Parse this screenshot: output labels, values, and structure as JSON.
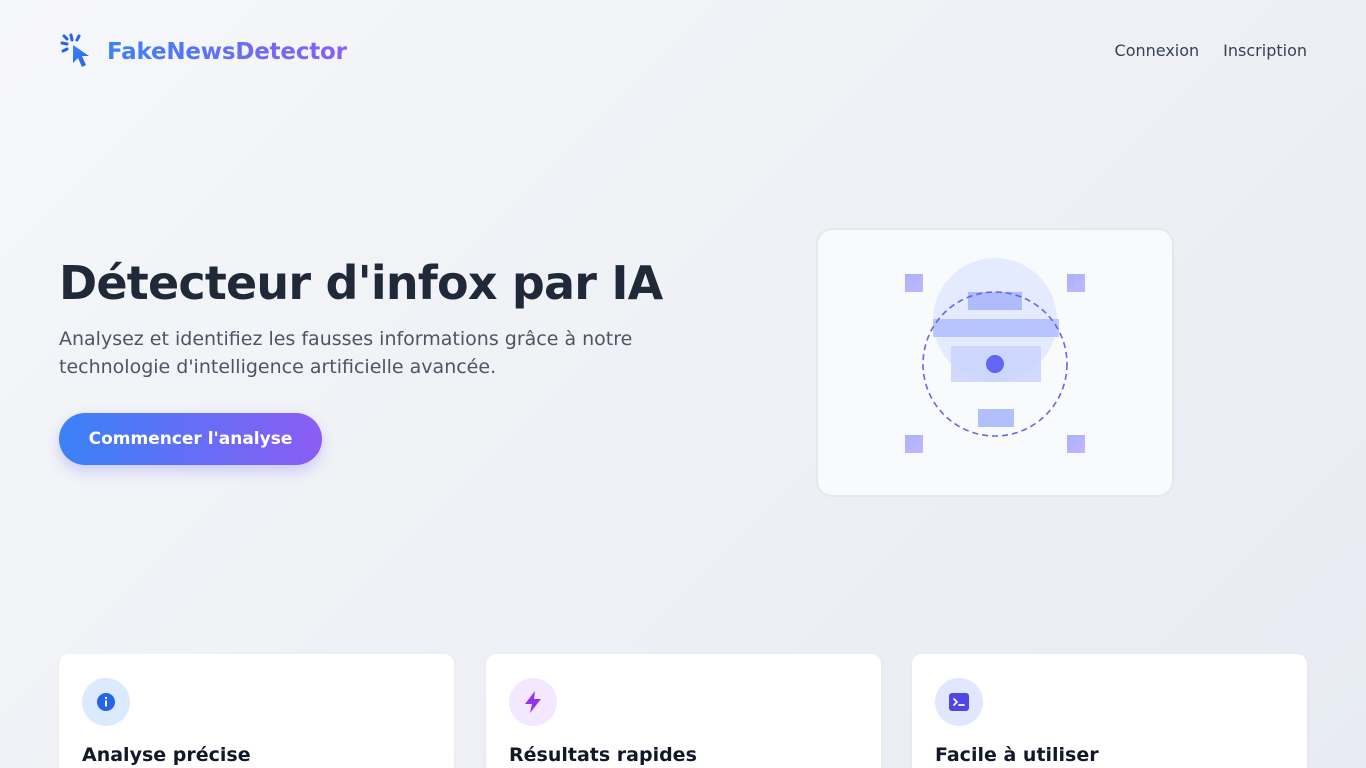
{
  "header": {
    "logo_text": "FakeNewsDetector",
    "nav": {
      "login": "Connexion",
      "signup": "Inscription"
    }
  },
  "hero": {
    "title": "Détecteur d'infox par IA",
    "subtitle": "Analysez et identifiez les fausses informations grâce à notre technologie d'intelligence artificielle avancée.",
    "cta_label": "Commencer l'analyse"
  },
  "features": [
    {
      "title": "Analyse précise",
      "icon": "info-icon",
      "icon_bg": "#dbeafe",
      "icon_color": "#2563eb"
    },
    {
      "title": "Résultats rapides",
      "icon": "lightning-icon",
      "icon_bg": "#f3e8ff",
      "icon_color": "#9333ea"
    },
    {
      "title": "Facile à utiliser",
      "icon": "terminal-icon",
      "icon_bg": "#e0e7ff",
      "icon_color": "#4f46e5"
    }
  ],
  "colors": {
    "gradient_start": "#3b82f6",
    "gradient_end": "#8b5cf6",
    "heading": "#1f2937",
    "body_text": "#4b5563"
  }
}
